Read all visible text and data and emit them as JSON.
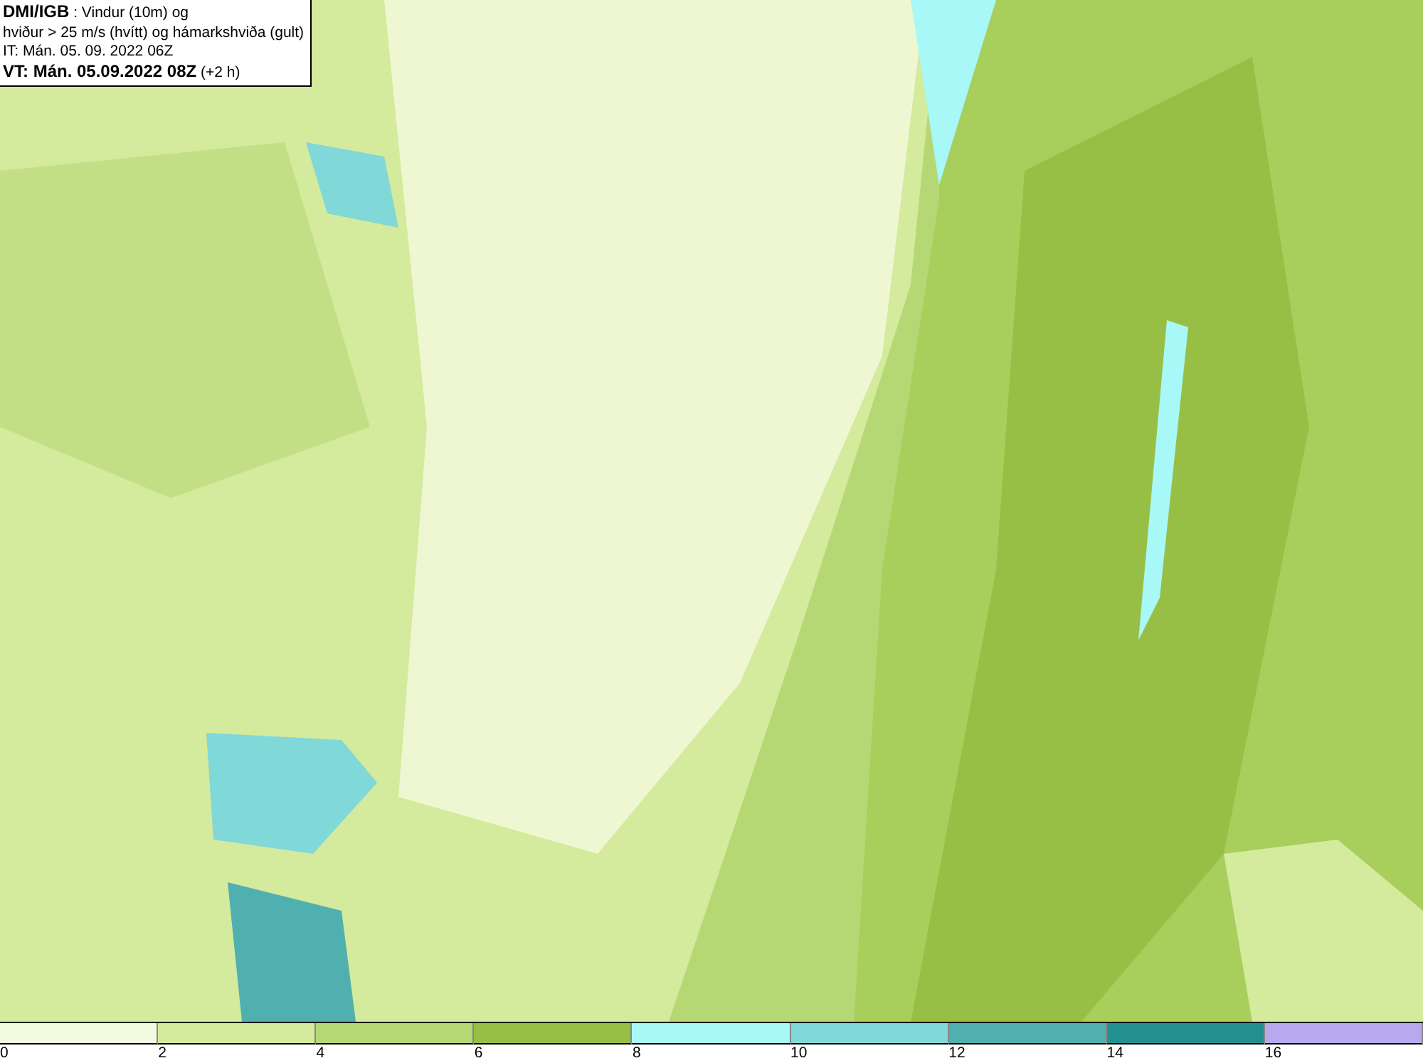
{
  "title_box": {
    "lines": [
      "**DMI/IGB** : Vindur (10m) og",
      "hviður > 25 m/s (hvítt) og hámarkshviða (gult)",
      "IT: Mán. 05. 09. 2022 06Z",
      "**VT: Mán. 05.09.2022 08Z** (+2 h)"
    ]
  },
  "legend": {
    "bins": [
      {
        "color": "#f4fadf",
        "label": "0"
      },
      {
        "color": "#d4ea9c",
        "label": "2"
      },
      {
        "color": "#b5d874",
        "label": "4"
      },
      {
        "color": "#98bf45",
        "label": "6"
      },
      {
        "color": "#a8f8f8",
        "label": "8"
      },
      {
        "color": "#80d8d8",
        "label": "10"
      },
      {
        "color": "#50b0b0",
        "label": "12"
      },
      {
        "color": "#239090",
        "label": "14"
      },
      {
        "color": "#b8a8f0",
        "label": "16"
      }
    ]
  }
}
